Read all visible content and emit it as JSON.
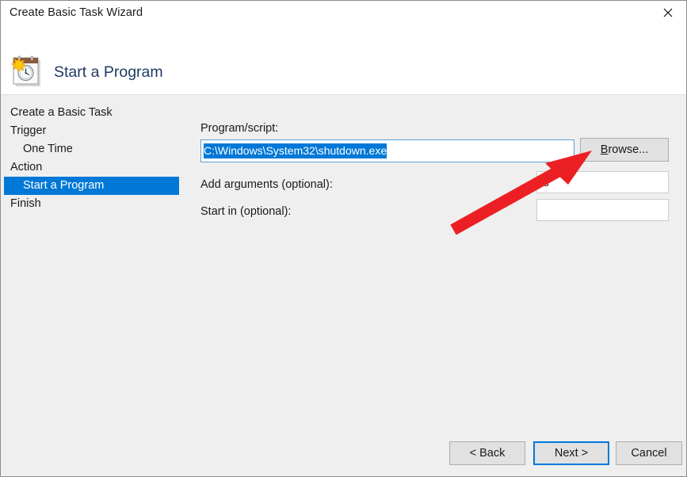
{
  "window": {
    "title": "Create Basic Task Wizard",
    "close_icon": "close-icon"
  },
  "header": {
    "title": "Start a Program",
    "icon": "task-scheduler-clock-calendar-icon"
  },
  "sidebar": {
    "items": [
      {
        "label": "Create a Basic Task",
        "active": false,
        "sub": false
      },
      {
        "label": "Trigger",
        "active": false,
        "sub": false
      },
      {
        "label": "One Time",
        "active": false,
        "sub": true
      },
      {
        "label": "Action",
        "active": false,
        "sub": false
      },
      {
        "label": "Start a Program",
        "active": true,
        "sub": true
      },
      {
        "label": "Finish",
        "active": false,
        "sub": false
      }
    ]
  },
  "form": {
    "program_label": "Program/script:",
    "program_value": "C:\\Windows\\System32\\shutdown.exe",
    "program_placeholder": "",
    "browse_label": "Browse...",
    "browse_accel": "B",
    "browse_rest": "rowse...",
    "arguments_label": "Add arguments (optional):",
    "arguments_value": "-s",
    "arguments_placeholder": "",
    "startin_label": "Start in (optional):",
    "startin_value": "",
    "startin_placeholder": ""
  },
  "footer": {
    "back_label": "< Back",
    "next_label": "Next >",
    "cancel_label": "Cancel"
  },
  "annotation": {
    "arrow_color": "#ec2024",
    "arrow_target": "browse-button"
  },
  "colors": {
    "accent": "#0078d7",
    "header_title": "#1f3a63",
    "body_bg": "#efefef",
    "button_bg": "#e1e1e1",
    "annotation_red": "#ec2024"
  }
}
